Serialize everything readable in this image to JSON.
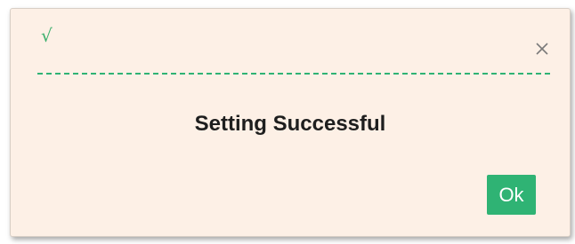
{
  "dialog": {
    "header": {
      "status_icon": "checkmark-icon",
      "status_glyph": "√",
      "close_icon": "close-icon"
    },
    "message": "Setting Successful",
    "ok_label": "Ok"
  },
  "colors": {
    "accent": "#2fb374",
    "background": "#fdf0e6",
    "close_icon": "#7a7a7a",
    "message_text": "#1e1e1e"
  }
}
